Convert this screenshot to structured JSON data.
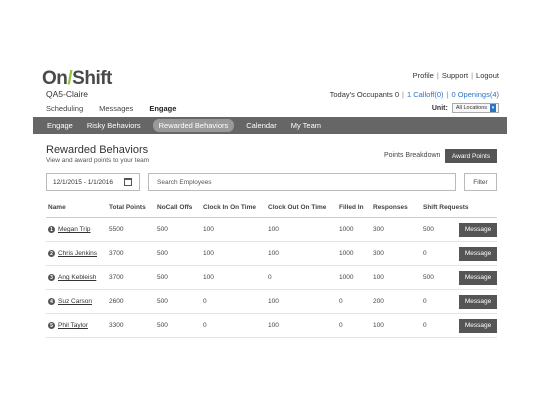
{
  "brand": {
    "logo_left": "On",
    "logo_slash": "/",
    "logo_right": "Shift",
    "org_name": "QA5-Claire"
  },
  "header": {
    "links": [
      "Profile",
      "Support",
      "Logout"
    ],
    "occupants": "Today's Occupants 0",
    "callofs": "1 Calloff(0)",
    "openings": "0 Openings(4)"
  },
  "topnav": {
    "items": [
      "Scheduling",
      "Messages",
      "Engage"
    ],
    "active": "Engage"
  },
  "unit": {
    "label": "Unit:",
    "value": "All Locations"
  },
  "subnav": {
    "items": [
      "Engage",
      "Risky Behaviors",
      "Rewarded Behaviors",
      "Calendar",
      "My Team"
    ],
    "active": "Rewarded Behaviors"
  },
  "page": {
    "title": "Rewarded Behaviors",
    "subtitle": "View and award points to your team",
    "points_breakdown": "Points Breakdown",
    "award_points": "Award Points"
  },
  "filters": {
    "date_range": "12/1/2015 - 1/1/2016",
    "search_placeholder": "Search Employees",
    "filter_label": "Filter"
  },
  "table": {
    "headers": [
      "Name",
      "Total Points",
      "NoCall Offs",
      "Clock In On Time",
      "Clock Out On Time",
      "Filled In",
      "Responses",
      "Shift Requests"
    ],
    "rows": [
      {
        "rank": "1",
        "name": "Megan Trip",
        "total": "5500",
        "nocall": "500",
        "clockin": "100",
        "clockout": "100",
        "filled": "1000",
        "responses": "300",
        "shift": "500",
        "action": "Message"
      },
      {
        "rank": "2",
        "name": "Chris Jenkins",
        "total": "3700",
        "nocall": "500",
        "clockin": "100",
        "clockout": "100",
        "filled": "1000",
        "responses": "300",
        "shift": "0",
        "action": "Message"
      },
      {
        "rank": "3",
        "name": "Ang Kebleish",
        "total": "3700",
        "nocall": "500",
        "clockin": "100",
        "clockout": "0",
        "filled": "1000",
        "responses": "100",
        "shift": "500",
        "action": "Message"
      },
      {
        "rank": "4",
        "name": "Suz Carson",
        "total": "2600",
        "nocall": "500",
        "clockin": "0",
        "clockout": "100",
        "filled": "0",
        "responses": "200",
        "shift": "0",
        "action": "Message"
      },
      {
        "rank": "5",
        "name": "Phil Taylor",
        "total": "3300",
        "nocall": "500",
        "clockin": "0",
        "clockout": "100",
        "filled": "0",
        "responses": "100",
        "shift": "0",
        "action": "Message"
      }
    ]
  },
  "colors": {
    "nav_bg": "#666666",
    "button_bg": "#555555",
    "logo_accent": "#8dc63f",
    "link": "#2a73c5"
  },
  "icons": {
    "calendar": "calendar-icon",
    "dropdown": "chevron-down-icon"
  }
}
